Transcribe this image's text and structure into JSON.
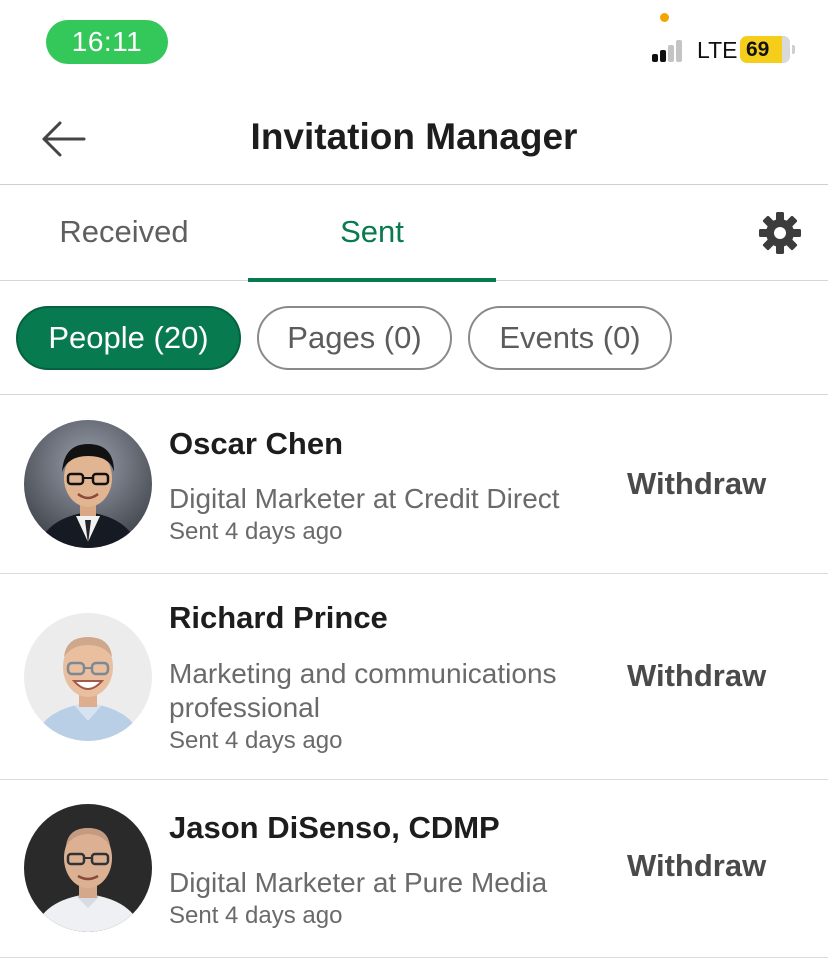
{
  "status_bar": {
    "time": "16:11",
    "network": "LTE",
    "battery": "69",
    "colors": {
      "time_pill": "#34c759",
      "battery": "#f5cd1b",
      "dot": "#f4a300"
    }
  },
  "header": {
    "title": "Invitation Manager",
    "back_icon": "arrow-left-icon"
  },
  "tabs": [
    {
      "label": "Received",
      "active": false
    },
    {
      "label": "Sent",
      "active": true
    }
  ],
  "settings_icon": "gear-icon",
  "filters": [
    {
      "label": "People (20)",
      "active": true
    },
    {
      "label": "Pages (0)",
      "active": false
    },
    {
      "label": "Events (0)",
      "active": false
    }
  ],
  "invitations": [
    {
      "name": "Oscar Chen",
      "headline": "Digital Marketer at Credit Direct",
      "sent": "Sent 4 days ago",
      "action": "Withdraw"
    },
    {
      "name": "Richard Prince",
      "headline": "Marketing and communications professional",
      "sent": "Sent 4 days ago",
      "action": "Withdraw"
    },
    {
      "name": "Jason DiSenso, CDMP",
      "headline": "Digital Marketer at Pure Media",
      "sent": "Sent 4 days ago",
      "action": "Withdraw"
    }
  ],
  "accent_color": "#087a4f"
}
